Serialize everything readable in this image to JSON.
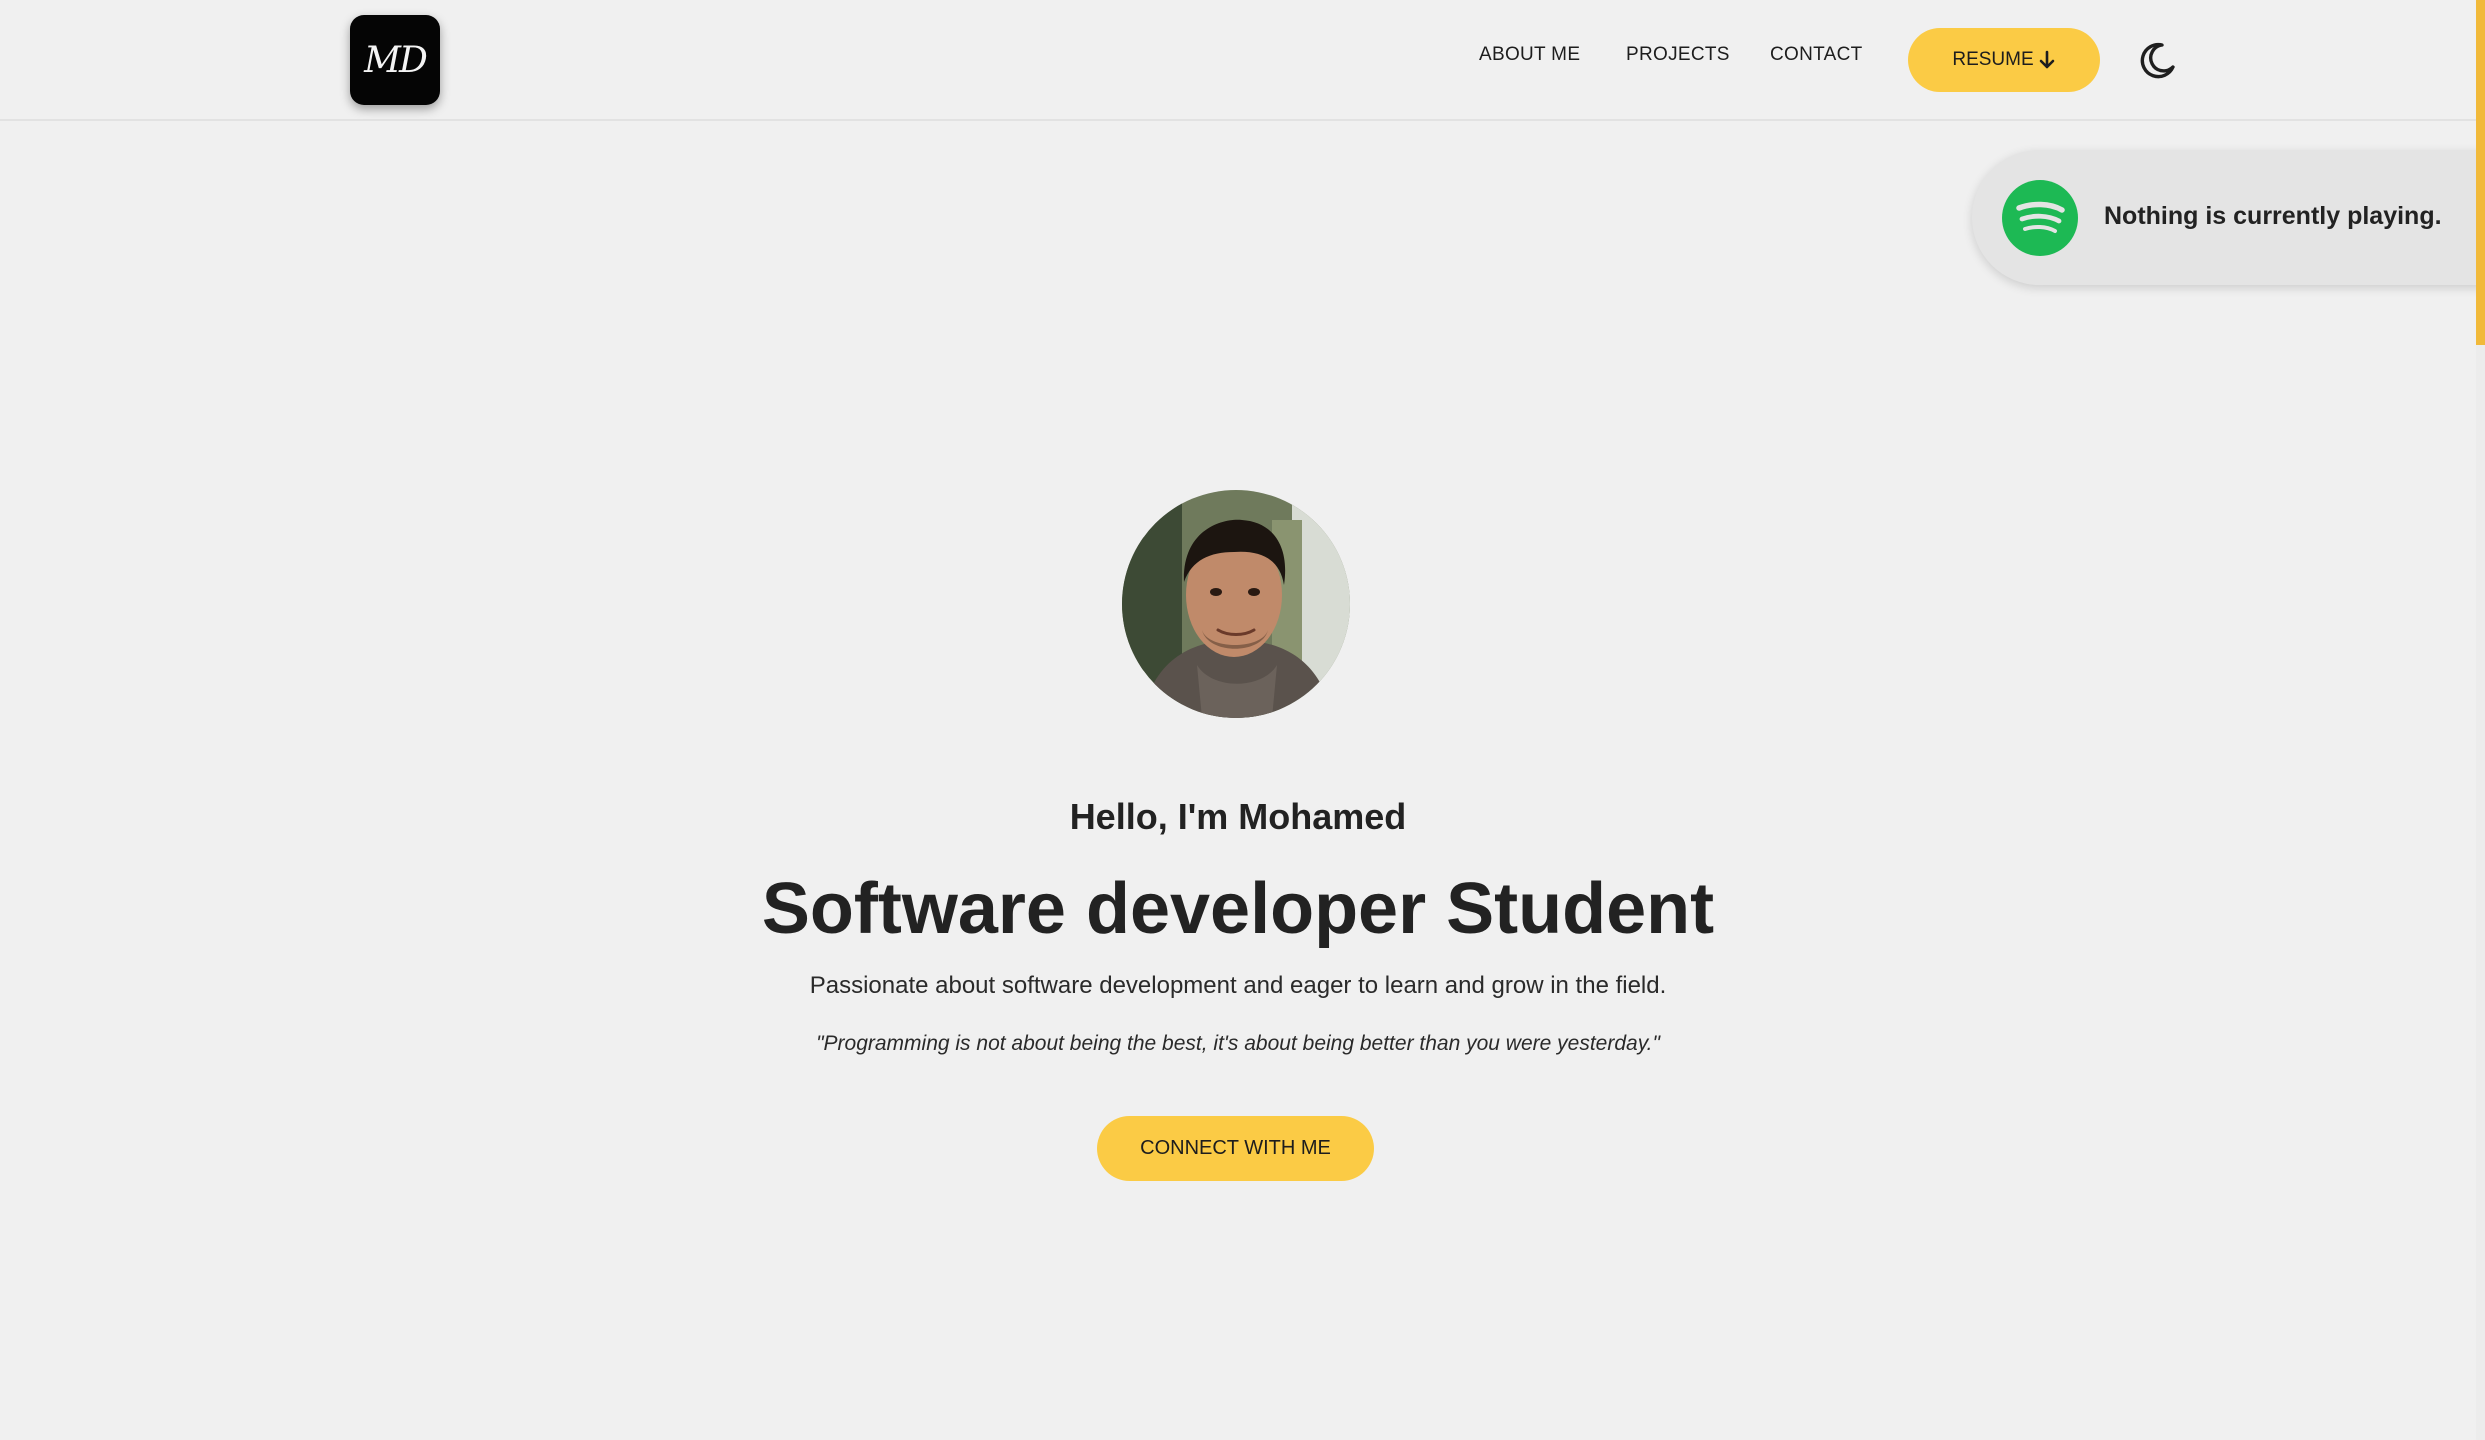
{
  "header": {
    "logo_text": "MD",
    "nav": {
      "about": "ABOUT ME",
      "projects": "PROJECTS",
      "contact": "CONTACT"
    },
    "resume_label": "RESUME",
    "resume_icon": "arrow-down-icon",
    "theme_toggle_icon": "moon-icon"
  },
  "spotify": {
    "icon": "spotify-icon",
    "status": "Nothing is currently playing."
  },
  "hero": {
    "greeting": "Hello, I'm Mohamed",
    "title": "Software developer Student",
    "subtitle": "Passionate about software development and eager to learn and grow in the field.",
    "quote": "\"Programming is not about being the best, it's about being better than you were yesterday.\"",
    "cta_label": "CONNECT WITH ME"
  },
  "colors": {
    "accent": "#fbcb45",
    "background": "#f0f0f0",
    "spotify_green": "#1db954",
    "text": "#222222"
  }
}
